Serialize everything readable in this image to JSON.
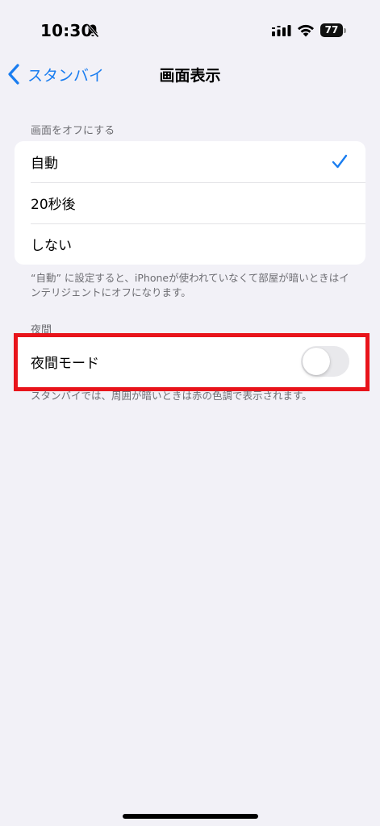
{
  "status_bar": {
    "time": "10:30",
    "battery": "77",
    "icons": [
      "bell-slash-icon",
      "cellular-signal-icon",
      "wifi-icon",
      "battery-icon"
    ]
  },
  "nav": {
    "back_label": "スタンバイ",
    "title": "画面表示"
  },
  "screen_off": {
    "header": "画面をオフにする",
    "options": [
      {
        "label": "自動",
        "selected": true
      },
      {
        "label": "20秒後",
        "selected": false
      },
      {
        "label": "しない",
        "selected": false
      }
    ],
    "footnote": "“自動” に設定すると、iPhoneが使われていなくて部屋が暗いときはインテリジェントにオフになります。"
  },
  "night": {
    "header": "夜間",
    "toggle_label": "夜間モード",
    "toggle_on": false,
    "footnote": "スタンバイでは、周囲が暗いときは赤の色調で表示されます。"
  },
  "colors": {
    "accent": "#1a7df0",
    "background": "#f2f1f7",
    "highlight": "#e8141b"
  }
}
